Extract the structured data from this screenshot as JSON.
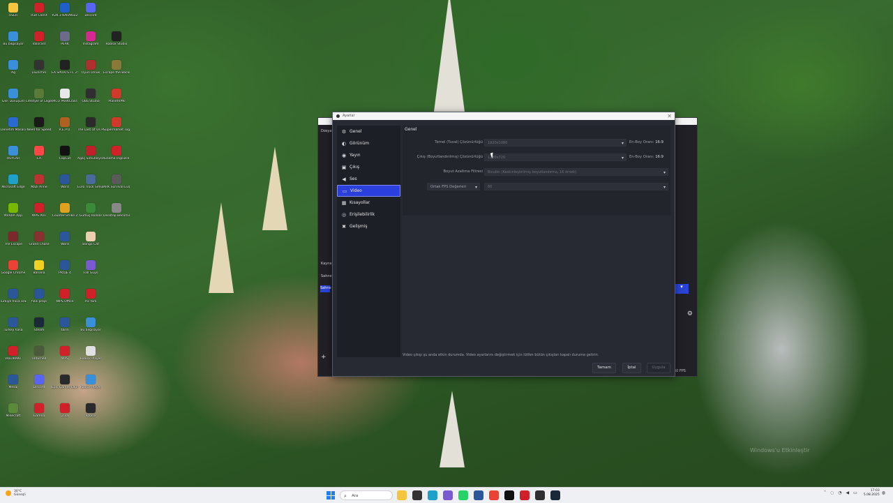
{
  "desktop": {
    "icons": [
      {
        "label": "USER",
        "color": "#f5c542"
      },
      {
        "label": "Riot Client",
        "color": "#d0202a"
      },
      {
        "label": "R2K 3 KARAKSIZ",
        "color": "#1f5fc8"
      },
      {
        "label": "Discord",
        "color": "#5865f2"
      },
      {
        "label": "Bu bilgisayar",
        "color": "#3b8fd9"
      },
      {
        "label": "Valorant",
        "color": "#d0202a"
      },
      {
        "label": "PEAK",
        "color": "#6b6b8a"
      },
      {
        "label": "Instagram",
        "color": "#d6298f"
      },
      {
        "label": "Roblox Studio",
        "color": "#222222"
      },
      {
        "label": "Ağ",
        "color": "#3b8fd9"
      },
      {
        "label": "Launcher",
        "color": "#333333"
      },
      {
        "label": "EA SPORTS FC 25",
        "color": "#222222"
      },
      {
        "label": "Oyun Ünlük",
        "color": "#b03030"
      },
      {
        "label": "Escape the Backrooms",
        "color": "#8a7a3a"
      },
      {
        "label": "Geri Dönüşüm",
        "color": "#3b8fd9"
      },
      {
        "label": "Lifestyle of Legends",
        "color": "#5a7a3a"
      },
      {
        "label": "PICO PARKClass",
        "color": "#e8e8e8"
      },
      {
        "label": "OBS Studio",
        "color": "#302e31"
      },
      {
        "label": "PlanetVPN",
        "color": "#d03a2a"
      },
      {
        "label": "Denetim Masası",
        "color": "#2a6ad0"
      },
      {
        "label": "Need for Speed",
        "color": "#1a1a1a"
      },
      {
        "label": "R.E.P.O.",
        "color": "#b06020"
      },
      {
        "label": "The Last Of Us Part I",
        "color": "#2a2a2a"
      },
      {
        "label": "Supermarket Together",
        "color": "#d03a2a"
      },
      {
        "label": "HUYLAR",
        "color": "#3b8fd9"
      },
      {
        "label": "EA",
        "color": "#ff4747"
      },
      {
        "label": "CapCut",
        "color": "#111111"
      },
      {
        "label": "Ağaç Simülasyon",
        "color": "#c0202a"
      },
      {
        "label": "Sinema İngilizce",
        "color": "#d0202a"
      },
      {
        "label": "Microsoft Edge",
        "color": "#1fa0c8"
      },
      {
        "label": "Mazı Anne",
        "color": "#bb3333"
      },
      {
        "label": "Word",
        "color": "#2b579a"
      },
      {
        "label": "Euro Truck Simulator 2",
        "color": "#4a6a9a"
      },
      {
        "label": "ARK Survival Evolved",
        "color": "#5a5a5a"
      },
      {
        "label": "NVIDIA App",
        "color": "#76b900"
      },
      {
        "label": "WPS PDF",
        "color": "#d0202a"
      },
      {
        "label": "Counter-Strike 2",
        "color": "#e0a020"
      },
      {
        "label": "Gümüş İkonlar",
        "color": "#3a8a3a"
      },
      {
        "label": "Desktop Becoming",
        "color": "#888888"
      },
      {
        "label": "The Escape",
        "color": "#7a2a2a"
      },
      {
        "label": "Grand Chase",
        "color": "#8a3030"
      },
      {
        "label": "Word",
        "color": "#2b579a"
      },
      {
        "label": "Bongo Cat",
        "color": "#e8d0b0"
      },
      {
        "label": "Google Chrome",
        "color": "#ea4335"
      },
      {
        "label": "Banana",
        "color": "#f0d020"
      },
      {
        "label": "PROJE 4",
        "color": "#2b579a"
      },
      {
        "label": "Fall Guys",
        "color": "#7a5ad0"
      },
      {
        "label": "Türkiye hava aracı",
        "color": "#2b579a"
      },
      {
        "label": "fizik proje",
        "color": "#2b579a"
      },
      {
        "label": "WPS Office",
        "color": "#d0202a"
      },
      {
        "label": "mc fork",
        "color": "#d0202a"
      },
      {
        "label": "Turkey hasa",
        "color": "#2b579a"
      },
      {
        "label": "Steam",
        "color": "#1b2838"
      },
      {
        "label": "tarih",
        "color": "#2b579a"
      },
      {
        "label": "Bu bilgisayar",
        "color": "#3b8fd9"
      },
      {
        "label": "VALORANT",
        "color": "#d0202a"
      },
      {
        "label": "Unturned",
        "color": "#4a5a3a"
      },
      {
        "label": "WPS",
        "color": "#d0202a"
      },
      {
        "label": "Roblox Player",
        "color": "#e0e0e0"
      },
      {
        "label": "Mesaj",
        "color": "#2b579a"
      },
      {
        "label": "Discord",
        "color": "#5865f2"
      },
      {
        "label": "Epic Games Launcher",
        "color": "#2a2a2a"
      },
      {
        "label": "Roblox Player",
        "color": "#3b8fd9"
      },
      {
        "label": "Minecraft",
        "color": "#5a8a3a"
      },
      {
        "label": "Garena",
        "color": "#d0202a"
      },
      {
        "label": "Zula",
        "color": "#d0202a"
      },
      {
        "label": "Roblox",
        "color": "#2a2a2a"
      }
    ]
  },
  "obs_main": {
    "side_labels": [
      "Dosya",
      "Kaynak",
      "Sahne",
      "Sahne"
    ],
    "fps": "60 FPS"
  },
  "settings": {
    "title": "Ayarlar",
    "categories": [
      {
        "label": "Genel",
        "icon": "gear-icon",
        "glyph": "⚙"
      },
      {
        "label": "Görünüm",
        "icon": "palette-icon",
        "glyph": "◐"
      },
      {
        "label": "Yayın",
        "icon": "broadcast-icon",
        "glyph": "◉"
      },
      {
        "label": "Çıkış",
        "icon": "output-icon",
        "glyph": "▣"
      },
      {
        "label": "Ses",
        "icon": "speaker-icon",
        "glyph": "◀"
      },
      {
        "label": "Video",
        "icon": "monitor-icon",
        "glyph": "▭"
      },
      {
        "label": "Kısayollar",
        "icon": "keyboard-icon",
        "glyph": "▦"
      },
      {
        "label": "Erişilebilirlik",
        "icon": "accessibility-icon",
        "glyph": "◎"
      },
      {
        "label": "Gelişmiş",
        "icon": "wrench-icon",
        "glyph": "✖"
      }
    ],
    "active_category": "Video",
    "section_title": "Genel",
    "base_resolution": {
      "label": "Temel (Tuval) Çözünürlüğü",
      "value": "1920x1080",
      "ratio_label": "En-Boy Oranı:",
      "ratio": "16:9"
    },
    "output_resolution": {
      "label": "Çıkış (Boyutlandırılmış) Çözünürlüğü",
      "value": "1280x720",
      "ratio_label": "En-Boy Oranı:",
      "ratio": "16:9"
    },
    "downscale_filter": {
      "label": "Boyut Azaltma Filtresi",
      "value": "Bicubic (Keskinleştirilmiş boyutlandırma, 16 örnek)"
    },
    "fps": {
      "label": "Ortak FPS Değerleri",
      "value": "60"
    },
    "status_message": "Video çıkışı şu anda etkin durumda. Video ayarlarını değiştirmek için lütfen bütün çıkışları kapalı duruma getirin.",
    "buttons": {
      "ok": "Tamam",
      "cancel": "İptal",
      "apply": "Uygula"
    }
  },
  "taskbar": {
    "weather_temp": "30°C",
    "weather_desc": "Güneşli",
    "search_placeholder": "Ara",
    "apps": [
      {
        "name": "file-explorer",
        "color": "#f5c542"
      },
      {
        "name": "terminal",
        "color": "#333333"
      },
      {
        "name": "edge",
        "color": "#1fa0c8"
      },
      {
        "name": "copilot",
        "color": "#7a5ad0"
      },
      {
        "name": "whatsapp",
        "color": "#25d366"
      },
      {
        "name": "word",
        "color": "#2b579a"
      },
      {
        "name": "chrome",
        "color": "#ea4335"
      },
      {
        "name": "capcut",
        "color": "#111111"
      },
      {
        "name": "wps",
        "color": "#d0202a"
      },
      {
        "name": "obs",
        "color": "#302e31"
      },
      {
        "name": "steam",
        "color": "#1b2838"
      }
    ],
    "time": "17:03",
    "date": "5.08.2025"
  },
  "watermark": "Windows'u Etkinleştir"
}
